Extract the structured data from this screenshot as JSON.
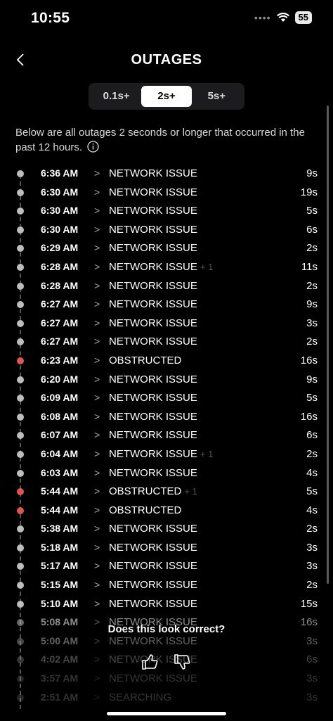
{
  "status": {
    "time": "10:55",
    "battery": "55"
  },
  "nav": {
    "title": "OUTAGES"
  },
  "filters": [
    {
      "label": "0.1s+",
      "active": false
    },
    {
      "label": "2s+",
      "active": true
    },
    {
      "label": "5s+",
      "active": false
    }
  ],
  "description": "Below are all outages 2 seconds or longer that occurred in the past 12 hours.",
  "outages": [
    {
      "time": "6:36 AM",
      "label": "NETWORK ISSUE",
      "extra": "",
      "duration": "9s",
      "status": "gray"
    },
    {
      "time": "6:30 AM",
      "label": "NETWORK ISSUE",
      "extra": "",
      "duration": "19s",
      "status": "gray"
    },
    {
      "time": "6:30 AM",
      "label": "NETWORK ISSUE",
      "extra": "",
      "duration": "5s",
      "status": "gray"
    },
    {
      "time": "6:30 AM",
      "label": "NETWORK ISSUE",
      "extra": "",
      "duration": "6s",
      "status": "gray"
    },
    {
      "time": "6:29 AM",
      "label": "NETWORK ISSUE",
      "extra": "",
      "duration": "2s",
      "status": "gray"
    },
    {
      "time": "6:28 AM",
      "label": "NETWORK ISSUE",
      "extra": "+ 1",
      "duration": "11s",
      "status": "gray"
    },
    {
      "time": "6:28 AM",
      "label": "NETWORK ISSUE",
      "extra": "",
      "duration": "2s",
      "status": "gray"
    },
    {
      "time": "6:27 AM",
      "label": "NETWORK ISSUE",
      "extra": "",
      "duration": "9s",
      "status": "gray"
    },
    {
      "time": "6:27 AM",
      "label": "NETWORK ISSUE",
      "extra": "",
      "duration": "3s",
      "status": "gray"
    },
    {
      "time": "6:27 AM",
      "label": "NETWORK ISSUE",
      "extra": "",
      "duration": "2s",
      "status": "gray"
    },
    {
      "time": "6:23 AM",
      "label": "OBSTRUCTED",
      "extra": "",
      "duration": "16s",
      "status": "red"
    },
    {
      "time": "6:20 AM",
      "label": "NETWORK ISSUE",
      "extra": "",
      "duration": "9s",
      "status": "gray"
    },
    {
      "time": "6:09 AM",
      "label": "NETWORK ISSUE",
      "extra": "",
      "duration": "5s",
      "status": "gray"
    },
    {
      "time": "6:08 AM",
      "label": "NETWORK ISSUE",
      "extra": "",
      "duration": "16s",
      "status": "gray"
    },
    {
      "time": "6:07 AM",
      "label": "NETWORK ISSUE",
      "extra": "",
      "duration": "6s",
      "status": "gray"
    },
    {
      "time": "6:04 AM",
      "label": "NETWORK ISSUE",
      "extra": "+ 1",
      "duration": "2s",
      "status": "gray"
    },
    {
      "time": "6:03 AM",
      "label": "NETWORK ISSUE",
      "extra": "",
      "duration": "4s",
      "status": "gray"
    },
    {
      "time": "5:44 AM",
      "label": "OBSTRUCTED",
      "extra": "+ 1",
      "duration": "5s",
      "status": "red"
    },
    {
      "time": "5:44 AM",
      "label": "OBSTRUCTED",
      "extra": "",
      "duration": "4s",
      "status": "red"
    },
    {
      "time": "5:38 AM",
      "label": "NETWORK ISSUE",
      "extra": "",
      "duration": "2s",
      "status": "gray"
    },
    {
      "time": "5:18 AM",
      "label": "NETWORK ISSUE",
      "extra": "",
      "duration": "3s",
      "status": "gray"
    },
    {
      "time": "5:17 AM",
      "label": "NETWORK ISSUE",
      "extra": "",
      "duration": "3s",
      "status": "gray"
    },
    {
      "time": "5:15 AM",
      "label": "NETWORK ISSUE",
      "extra": "",
      "duration": "2s",
      "status": "gray"
    },
    {
      "time": "5:10 AM",
      "label": "NETWORK ISSUE",
      "extra": "",
      "duration": "15s",
      "status": "gray"
    },
    {
      "time": "5:08 AM",
      "label": "NETWORK ISSUE",
      "extra": "",
      "duration": "16s",
      "status": "gray"
    },
    {
      "time": "5:00 AM",
      "label": "NETWORK ISSUE",
      "extra": "",
      "duration": "3s",
      "status": "gray"
    },
    {
      "time": "4:02 AM",
      "label": "NETWORK ISSUE",
      "extra": "",
      "duration": "6s",
      "status": "gray"
    },
    {
      "time": "3:57 AM",
      "label": "NETWORK ISSUE",
      "extra": "",
      "duration": "3s",
      "status": "gray"
    },
    {
      "time": "2:51 AM",
      "label": "SEARCHING",
      "extra": "",
      "duration": "3s",
      "status": "gray"
    }
  ],
  "feedback": {
    "question": "Does this look correct?"
  },
  "colors": {
    "background": "#000000",
    "obstructed": "#e0564e",
    "dot": "#bdbdbd"
  },
  "icons": {
    "back": "chevron-left-icon",
    "info": "info-icon",
    "wifi": "wifi-icon",
    "thumbs_up": "thumbs-up-icon",
    "thumbs_down": "thumbs-down-icon"
  }
}
